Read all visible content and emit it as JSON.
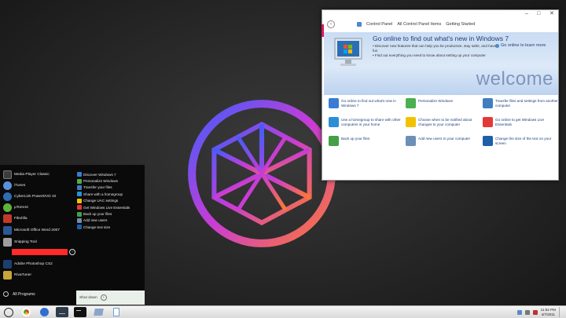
{
  "control_panel": {
    "breadcrumbs": [
      "Control Panel",
      "All Control Panel Items",
      "Getting Started"
    ],
    "banner": {
      "title": "Go online to find out what's new in Windows 7",
      "bullets": [
        "• Discover new features that can help you be productive, stay safer, and have fun",
        "• Find out everything you need to know about setting up your computer"
      ],
      "link": "Go online to learn more",
      "watermark": "welcome"
    },
    "tasks": [
      {
        "label": "Go online to find out what's new in Windows 7",
        "color": "#3a7bd5"
      },
      {
        "label": "Personalize Windows",
        "color": "#4caf50"
      },
      {
        "label": "Transfer files and settings from another computer",
        "color": "#3f7fbf"
      },
      {
        "label": "Use a homegroup to share with other computers in your home",
        "color": "#2b8fd6"
      },
      {
        "label": "Choose when to be notified about changes to your computer",
        "color": "#f2c200"
      },
      {
        "label": "Go online to get Windows Live Essentials",
        "color": "#e53935"
      },
      {
        "label": "Back up your files",
        "color": "#43a047"
      },
      {
        "label": "Add new users to your computer",
        "color": "#6d8fb5"
      },
      {
        "label": "Change the size of the text on your screen",
        "color": "#1e5fa8"
      }
    ]
  },
  "start_menu": {
    "programs": [
      {
        "label": "Media Player Classic",
        "color": "#3c3c3c"
      },
      {
        "label": "iTunes",
        "color": "#5b8fd9"
      },
      {
        "label": "CyberLink PowerDVD 10",
        "color": "#2e6cb3"
      },
      {
        "label": "µTorrent",
        "color": "#5fb33c"
      },
      {
        "label": "FileZilla",
        "color": "#c0392b"
      },
      {
        "label": "Microsoft Office Word 2007",
        "color": "#2b5797"
      },
      {
        "label": "Snipping Tool",
        "color": "#9e9e9e"
      },
      {
        "label": "Adobe Photoshop CS2",
        "color": "#1c3f73"
      },
      {
        "label": "RivaTuner",
        "color": "#c7a53a"
      }
    ],
    "all_programs": "All Programs",
    "task_links": [
      "Discover Windows 7",
      "Personalize Windows",
      "Transfer your files",
      "Share with a homegroup",
      "Change UAC settings",
      "Get Windows Live Essentials",
      "Back up your files",
      "Add new users",
      "Change text size"
    ],
    "shutdown": "Shut down"
  },
  "taskbar": {
    "apps": [
      {
        "name": "chrome",
        "color": "#e94235"
      },
      {
        "name": "media-player",
        "color": "#2f6fd0"
      },
      {
        "name": "lightroom",
        "color": "#2d3b4a"
      },
      {
        "name": "command-prompt",
        "color": "#111111"
      },
      {
        "name": "explorer",
        "color": "#8aa5c8"
      },
      {
        "name": "notepad",
        "color": "#6a9fd4"
      }
    ],
    "time": "11:52 PM",
    "date": "4/7/2011"
  }
}
